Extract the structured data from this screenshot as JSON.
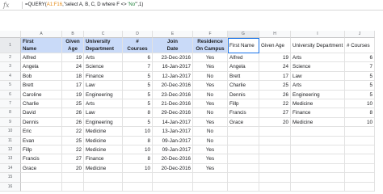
{
  "formula_bar": {
    "fx_label": "fx",
    "formula_prefix": "=QUERY(",
    "formula_range": "A1:F16",
    "formula_mid": ",\"select A, B, C, D where F <> ",
    "formula_str": "'No'",
    "formula_suffix": "\",1)"
  },
  "columns": [
    "",
    "A",
    "B",
    "C",
    "D",
    "E",
    "F",
    "G",
    "H",
    "I",
    "J"
  ],
  "header": {
    "line1": [
      "First",
      "Given",
      "University",
      "#",
      "Join",
      "Residence"
    ],
    "line2": [
      "Name",
      "Age",
      "Department",
      "Courses",
      "Date",
      "On Campus"
    ],
    "query_headers": [
      "First Name",
      "Given Age",
      "University Department",
      "# Courses"
    ]
  },
  "row_numbers": [
    "1",
    "2",
    "3",
    "4",
    "5",
    "6",
    "7",
    "8",
    "9",
    "10",
    "11",
    "12",
    "13",
    "14",
    "15",
    "16"
  ],
  "rows": [
    [
      "Alfred",
      "19",
      "Arts",
      "6",
      "23-Dec-2016",
      "Yes"
    ],
    [
      "Angela",
      "24",
      "Science",
      "7",
      "16-Jan-2017",
      "Yes"
    ],
    [
      "Bob",
      "18",
      "Finance",
      "5",
      "12-Jan-2017",
      "No"
    ],
    [
      "Brett",
      "17",
      "Law",
      "5",
      "20-Dec-2016",
      "Yes"
    ],
    [
      "Caroline",
      "19",
      "Engineering",
      "5",
      "23-Dec-2016",
      "No"
    ],
    [
      "Charlie",
      "25",
      "Arts",
      "5",
      "21-Dec-2016",
      "Yes"
    ],
    [
      "David",
      "26",
      "Law",
      "8",
      "29-Dec-2016",
      "No"
    ],
    [
      "Dennis",
      "26",
      "Engineering",
      "5",
      "14-Jan-2017",
      "Yes"
    ],
    [
      "Eric",
      "22",
      "Medicine",
      "10",
      "13-Jan-2017",
      "No"
    ],
    [
      "Evan",
      "25",
      "Medicine",
      "8",
      "09-Jan-2017",
      "No"
    ],
    [
      "Fillp",
      "22",
      "Medicine",
      "10",
      "09-Jan-2017",
      "Yes"
    ],
    [
      "Francis",
      "27",
      "Finance",
      "8",
      "20-Dec-2016",
      "Yes"
    ],
    [
      "Grace",
      "20",
      "Medicine",
      "10",
      "20-Dec-2016",
      "Yes"
    ]
  ],
  "query_rows": [
    [
      "Alfred",
      "19",
      "Arts",
      "6"
    ],
    [
      "Angela",
      "24",
      "Science",
      "7"
    ],
    [
      "Brett",
      "17",
      "Law",
      "5"
    ],
    [
      "Charlie",
      "25",
      "Arts",
      "5"
    ],
    [
      "Dennis",
      "26",
      "Engineering",
      "5"
    ],
    [
      "Fillp",
      "22",
      "Medicine",
      "10"
    ],
    [
      "Francis",
      "27",
      "Finance",
      "8"
    ],
    [
      "Grace",
      "20",
      "Medicine",
      "10"
    ]
  ]
}
